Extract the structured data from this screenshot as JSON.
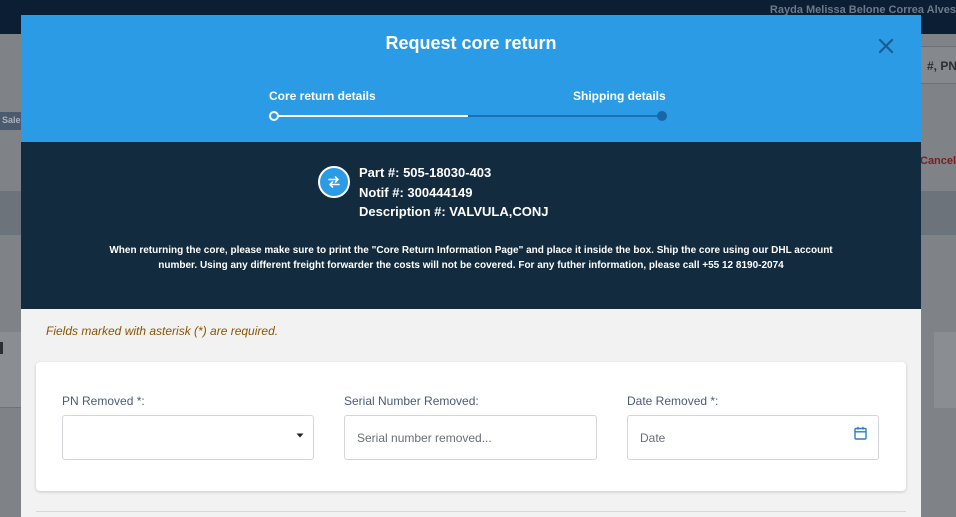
{
  "background": {
    "user_name": "Rayda Melissa Belone Correa Alves",
    "search_fragment": "#, PN",
    "sidebar_tag": "Sales",
    "cancel_fragment": "Cancel"
  },
  "modal": {
    "title": "Request core return",
    "close_icon": "close-icon",
    "steps": [
      {
        "label": "Core return details",
        "state": "active"
      },
      {
        "label": "Shipping details",
        "state": "pending"
      }
    ],
    "step_progress": 0.5,
    "info": {
      "icon": "swap-arrows-icon",
      "part": "Part #: 505-18030-403",
      "notif": "Notif #: 300444149",
      "description": "Description #: VALVULA,CONJ",
      "notice": "When returning the core, please make sure to print the \"Core Return Information Page\" and place it inside the box. Ship the core using our DHL account number. Using any different freight forwarder the costs will not be covered. For any futher information, please call +55 12 8190-2074"
    },
    "required_note": "Fields marked with asterisk (*) are required.",
    "form": {
      "pn_removed": {
        "label": "PN Removed",
        "required_mark": "*:",
        "value": "",
        "icon": "caret-down-icon"
      },
      "serial_removed": {
        "label": "Serial Number Removed:",
        "placeholder": "Serial number removed...",
        "value": ""
      },
      "date_removed": {
        "label": "Date Removed",
        "required_mark": "*:",
        "placeholder": "Date",
        "icon": "calendar-icon"
      }
    }
  },
  "colors": {
    "header_blue": "#2b9be5",
    "info_navy": "#122b3f",
    "label_slate": "#4a5b75",
    "required_note_brown": "#8a5500"
  }
}
